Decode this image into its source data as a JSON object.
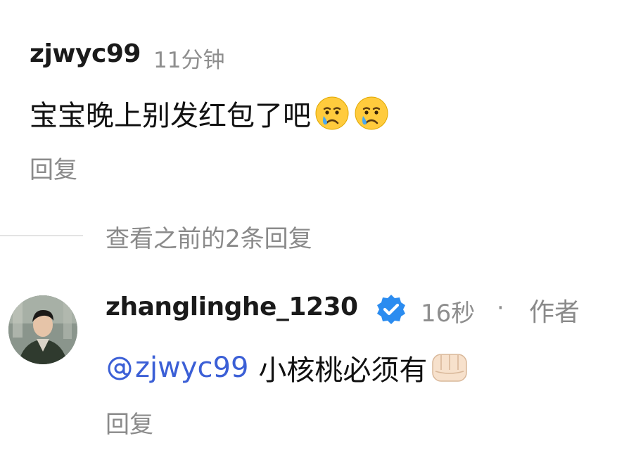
{
  "comment": {
    "username": "zjwyc99",
    "time": "11分钟",
    "text": "宝宝晚上别发红包了吧",
    "emojis": [
      "crying-face",
      "crying-face"
    ],
    "reply_label": "回复"
  },
  "thread": {
    "view_previous_label": "查看之前的2条回复"
  },
  "reply": {
    "username": "zhanglinghe_1230",
    "verified_badge": "verified-check-icon",
    "time": "16秒",
    "separator": "·",
    "author_tag": "作者",
    "mention": "zjwyc99",
    "text": "小核桃必须有",
    "emoji": "fist-bump",
    "reply_label": "回复"
  },
  "colors": {
    "mention": "#3b5fd6",
    "verified": "#2b8cf0",
    "muted": "#8a8a8a"
  }
}
